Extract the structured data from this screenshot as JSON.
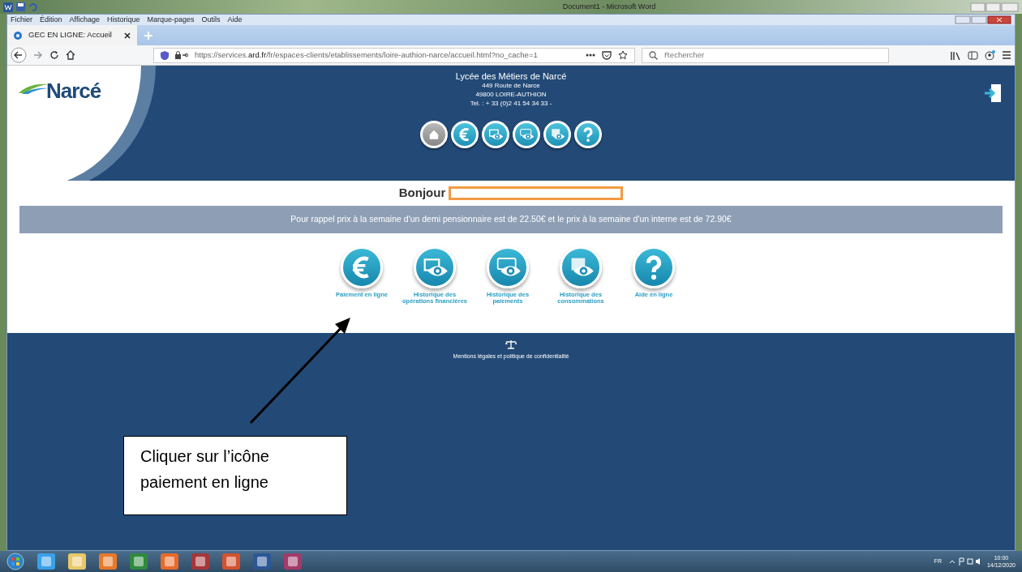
{
  "word_window": {
    "title": "Document1 - Microsoft Word"
  },
  "browser": {
    "menu": [
      "Fichier",
      "Édition",
      "Affichage",
      "Historique",
      "Marque-pages",
      "Outils",
      "Aide"
    ],
    "tabs": [
      {
        "label": "GEC EN LIGNE: Accueil",
        "selected": true
      }
    ],
    "url": "https://services.**ard.fr**/fr/espaces-clients/etablissements/loire-authion-narce/accueil.html?no_cache=1",
    "search": {
      "placeholder": "Rechercher"
    }
  },
  "site": {
    "logo": "Narcé",
    "school": {
      "name": "Lycée des Métiers de Narcé",
      "lines": [
        "449 Route de Narce",
        "49800 LOIRE-AUTHION",
        "Tel. : + 33 (0)2 41 54 34 33 -"
      ]
    },
    "nav_icons": [
      {
        "kind": "home",
        "selected": true
      },
      {
        "kind": "euro",
        "selected": false
      },
      {
        "kind": "folder-eye",
        "selected": false
      },
      {
        "kind": "card-eye",
        "selected": false
      },
      {
        "kind": "calendar-eye",
        "selected": false
      },
      {
        "kind": "help",
        "selected": false
      }
    ],
    "greeting": "Bonjour",
    "notice": "Pour rappel prix à la semaine d'un demi pensionnaire est de 22.50€ et le prix à la semaine d'un interne est de 72.90€",
    "apps": [
      {
        "kind": "euro",
        "label": "Paiement en ligne"
      },
      {
        "kind": "folder-eye",
        "label": "Historique des opérations financières"
      },
      {
        "kind": "card-eye",
        "label": "Historique des paiements"
      },
      {
        "kind": "calendar-eye",
        "label": "Historique des consommations"
      },
      {
        "kind": "help",
        "label": "Aide en ligne"
      }
    ],
    "footer": "Mentions légales et politique de confidentialité"
  },
  "annotation": {
    "text": "Cliquer sur l’icône paiement en ligne"
  },
  "taskbar": {
    "language": "FR",
    "time": "10:00",
    "date": "14/12/2020"
  }
}
